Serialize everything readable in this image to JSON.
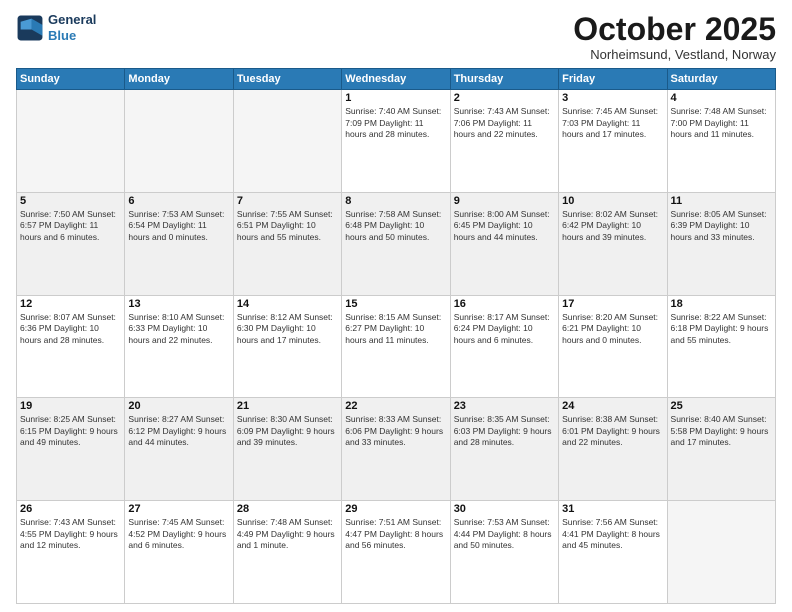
{
  "logo": {
    "line1": "General",
    "line2": "Blue"
  },
  "title": "October 2025",
  "subtitle": "Norheimsund, Vestland, Norway",
  "weekdays": [
    "Sunday",
    "Monday",
    "Tuesday",
    "Wednesday",
    "Thursday",
    "Friday",
    "Saturday"
  ],
  "weeks": [
    {
      "shaded": false,
      "days": [
        {
          "number": "",
          "info": ""
        },
        {
          "number": "",
          "info": ""
        },
        {
          "number": "",
          "info": ""
        },
        {
          "number": "1",
          "info": "Sunrise: 7:40 AM\nSunset: 7:09 PM\nDaylight: 11 hours\nand 28 minutes."
        },
        {
          "number": "2",
          "info": "Sunrise: 7:43 AM\nSunset: 7:06 PM\nDaylight: 11 hours\nand 22 minutes."
        },
        {
          "number": "3",
          "info": "Sunrise: 7:45 AM\nSunset: 7:03 PM\nDaylight: 11 hours\nand 17 minutes."
        },
        {
          "number": "4",
          "info": "Sunrise: 7:48 AM\nSunset: 7:00 PM\nDaylight: 11 hours\nand 11 minutes."
        }
      ]
    },
    {
      "shaded": true,
      "days": [
        {
          "number": "5",
          "info": "Sunrise: 7:50 AM\nSunset: 6:57 PM\nDaylight: 11 hours\nand 6 minutes."
        },
        {
          "number": "6",
          "info": "Sunrise: 7:53 AM\nSunset: 6:54 PM\nDaylight: 11 hours\nand 0 minutes."
        },
        {
          "number": "7",
          "info": "Sunrise: 7:55 AM\nSunset: 6:51 PM\nDaylight: 10 hours\nand 55 minutes."
        },
        {
          "number": "8",
          "info": "Sunrise: 7:58 AM\nSunset: 6:48 PM\nDaylight: 10 hours\nand 50 minutes."
        },
        {
          "number": "9",
          "info": "Sunrise: 8:00 AM\nSunset: 6:45 PM\nDaylight: 10 hours\nand 44 minutes."
        },
        {
          "number": "10",
          "info": "Sunrise: 8:02 AM\nSunset: 6:42 PM\nDaylight: 10 hours\nand 39 minutes."
        },
        {
          "number": "11",
          "info": "Sunrise: 8:05 AM\nSunset: 6:39 PM\nDaylight: 10 hours\nand 33 minutes."
        }
      ]
    },
    {
      "shaded": false,
      "days": [
        {
          "number": "12",
          "info": "Sunrise: 8:07 AM\nSunset: 6:36 PM\nDaylight: 10 hours\nand 28 minutes."
        },
        {
          "number": "13",
          "info": "Sunrise: 8:10 AM\nSunset: 6:33 PM\nDaylight: 10 hours\nand 22 minutes."
        },
        {
          "number": "14",
          "info": "Sunrise: 8:12 AM\nSunset: 6:30 PM\nDaylight: 10 hours\nand 17 minutes."
        },
        {
          "number": "15",
          "info": "Sunrise: 8:15 AM\nSunset: 6:27 PM\nDaylight: 10 hours\nand 11 minutes."
        },
        {
          "number": "16",
          "info": "Sunrise: 8:17 AM\nSunset: 6:24 PM\nDaylight: 10 hours\nand 6 minutes."
        },
        {
          "number": "17",
          "info": "Sunrise: 8:20 AM\nSunset: 6:21 PM\nDaylight: 10 hours\nand 0 minutes."
        },
        {
          "number": "18",
          "info": "Sunrise: 8:22 AM\nSunset: 6:18 PM\nDaylight: 9 hours\nand 55 minutes."
        }
      ]
    },
    {
      "shaded": true,
      "days": [
        {
          "number": "19",
          "info": "Sunrise: 8:25 AM\nSunset: 6:15 PM\nDaylight: 9 hours\nand 49 minutes."
        },
        {
          "number": "20",
          "info": "Sunrise: 8:27 AM\nSunset: 6:12 PM\nDaylight: 9 hours\nand 44 minutes."
        },
        {
          "number": "21",
          "info": "Sunrise: 8:30 AM\nSunset: 6:09 PM\nDaylight: 9 hours\nand 39 minutes."
        },
        {
          "number": "22",
          "info": "Sunrise: 8:33 AM\nSunset: 6:06 PM\nDaylight: 9 hours\nand 33 minutes."
        },
        {
          "number": "23",
          "info": "Sunrise: 8:35 AM\nSunset: 6:03 PM\nDaylight: 9 hours\nand 28 minutes."
        },
        {
          "number": "24",
          "info": "Sunrise: 8:38 AM\nSunset: 6:01 PM\nDaylight: 9 hours\nand 22 minutes."
        },
        {
          "number": "25",
          "info": "Sunrise: 8:40 AM\nSunset: 5:58 PM\nDaylight: 9 hours\nand 17 minutes."
        }
      ]
    },
    {
      "shaded": false,
      "days": [
        {
          "number": "26",
          "info": "Sunrise: 7:43 AM\nSunset: 4:55 PM\nDaylight: 9 hours\nand 12 minutes."
        },
        {
          "number": "27",
          "info": "Sunrise: 7:45 AM\nSunset: 4:52 PM\nDaylight: 9 hours\nand 6 minutes."
        },
        {
          "number": "28",
          "info": "Sunrise: 7:48 AM\nSunset: 4:49 PM\nDaylight: 9 hours\nand 1 minute."
        },
        {
          "number": "29",
          "info": "Sunrise: 7:51 AM\nSunset: 4:47 PM\nDaylight: 8 hours\nand 56 minutes."
        },
        {
          "number": "30",
          "info": "Sunrise: 7:53 AM\nSunset: 4:44 PM\nDaylight: 8 hours\nand 50 minutes."
        },
        {
          "number": "31",
          "info": "Sunrise: 7:56 AM\nSunset: 4:41 PM\nDaylight: 8 hours\nand 45 minutes."
        },
        {
          "number": "",
          "info": ""
        }
      ]
    }
  ]
}
